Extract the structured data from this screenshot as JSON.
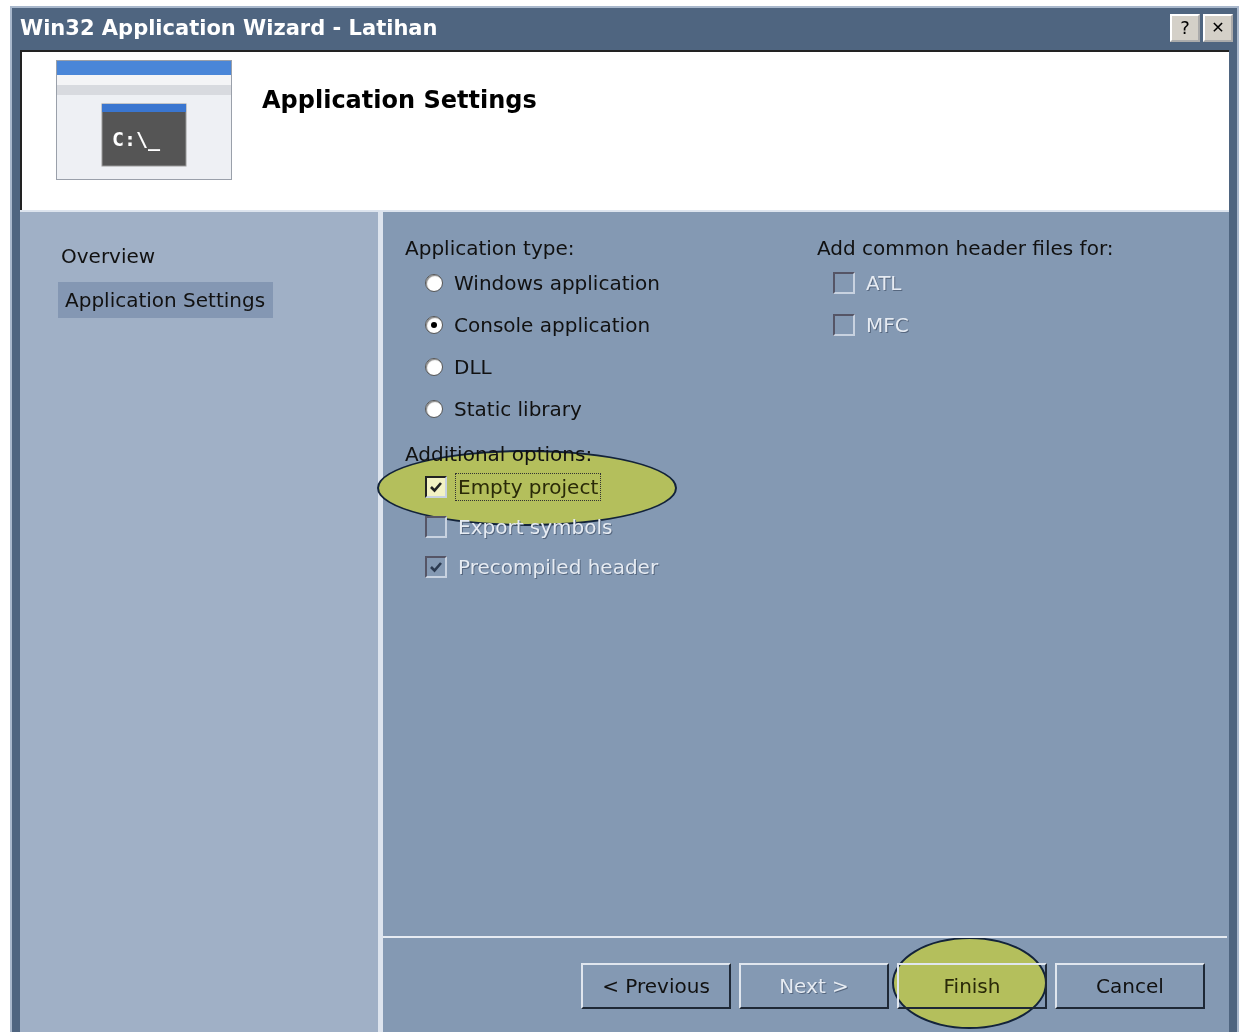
{
  "window": {
    "title": "Win32 Application Wizard - Latihan",
    "buttons": [
      {
        "kind": "help",
        "label": "?"
      },
      {
        "kind": "close",
        "label": "✕"
      }
    ]
  },
  "header": {
    "title": "Application Settings",
    "icon_text": "C:\\_"
  },
  "sidebar": {
    "items": [
      {
        "label": "Overview",
        "selected": false
      },
      {
        "label": "Application Settings",
        "selected": true
      }
    ]
  },
  "application_type": {
    "label": "Application type:",
    "options": [
      {
        "label": "Windows application",
        "selected": false
      },
      {
        "label": "Console application",
        "selected": true
      },
      {
        "label": "DLL",
        "selected": false
      },
      {
        "label": "Static library",
        "selected": false
      }
    ]
  },
  "additional_options": {
    "label": "Additional options:",
    "options": [
      {
        "label": "Empty project",
        "checked": true,
        "disabled": false,
        "focused": true,
        "highlighted": true
      },
      {
        "label": "Export symbols",
        "checked": false,
        "disabled": true,
        "focused": false,
        "highlighted": false
      },
      {
        "label": "Precompiled header",
        "checked": true,
        "disabled": true,
        "focused": false,
        "highlighted": false
      }
    ]
  },
  "header_files": {
    "label": "Add common header files for:",
    "options": [
      {
        "label": "ATL",
        "checked": false,
        "disabled": true
      },
      {
        "label": "MFC",
        "checked": false,
        "disabled": true
      }
    ]
  },
  "buttons": [
    {
      "label": "< Previous",
      "disabled": false,
      "highlighted": false
    },
    {
      "label": "Next >",
      "disabled": true,
      "highlighted": false
    },
    {
      "label": "Finish",
      "disabled": false,
      "highlighted": true
    },
    {
      "label": "Cancel",
      "disabled": false,
      "highlighted": false
    }
  ]
}
